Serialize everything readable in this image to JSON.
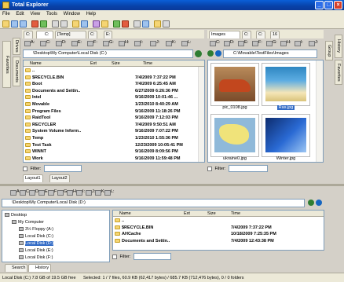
{
  "window": {
    "title": "Total Explorer"
  },
  "menu": [
    "File",
    "Edit",
    "View",
    "Tools",
    "Window",
    "Help"
  ],
  "left_panel": {
    "tabs": [
      "C:",
      "C:",
      "[Temp]",
      "C:",
      "E:"
    ],
    "drives": [
      "A:",
      "C:",
      "D:",
      "E:",
      "F:",
      "G:",
      "H:",
      "I:",
      "J:",
      "K:",
      "L:"
    ],
    "address": "\\Desktop\\My Computer\\Local Disk (C:)",
    "columns": {
      "name": "Name",
      "ext": "Ext",
      "size": "Size",
      "time": "Time"
    },
    "rows": [
      {
        "name": "..",
        "time": ""
      },
      {
        "name": "$RECYCLE.BIN",
        "time": "7/4/2009 7:37:22 PM"
      },
      {
        "name": "Boot",
        "time": "7/4/2009 6:25:45 AM"
      },
      {
        "name": "Documents and Settin..",
        "time": "6/27/2009 6:26:36 PM"
      },
      {
        "name": "Intel",
        "time": "9/16/2009 10:01:46 ..."
      },
      {
        "name": "Movable",
        "time": "1/23/2010 8:40:29 AM"
      },
      {
        "name": "Program Files",
        "time": "9/16/2009 11:18:26 PM"
      },
      {
        "name": "RaidTool",
        "time": "9/16/2009 7:12:03 PM"
      },
      {
        "name": "RECYCLER",
        "time": "7/4/2009 9:50:51 AM"
      },
      {
        "name": "System Volume Inform..",
        "time": "9/16/2009 7:07:22 PM"
      },
      {
        "name": "Temp",
        "time": "1/23/2010 1:55:36 PM"
      },
      {
        "name": "Test Task",
        "time": "12/23/2009 10:05:41 PM"
      },
      {
        "name": "WINNT",
        "time": "9/16/2009 8:09:56 PM"
      },
      {
        "name": "Work",
        "time": "9/16/2009 11:59:48 PM"
      }
    ],
    "filter_label": "Filter:",
    "layout_tabs": [
      "Layout1",
      "Layout2"
    ]
  },
  "right_panel": {
    "tabs": [
      "Images",
      "C:",
      "C:",
      "16"
    ],
    "drives": [
      "C:",
      "D:",
      "E:",
      "F:",
      "G:",
      "H:",
      "I:",
      "J:"
    ],
    "address": "C:\\Movable\\TestFiles\\Images",
    "thumbs": [
      {
        "name": "pic_0108.jpg",
        "selected": false
      },
      {
        "name": "Ras.jpg",
        "selected": true
      },
      {
        "name": "ukraine0.jpg",
        "selected": false
      },
      {
        "name": "Winter.jpg",
        "selected": false
      }
    ],
    "filter_label": "Filter:"
  },
  "side_tabs_left": [
    "Drives",
    "Documents",
    "Favorites"
  ],
  "side_tabs_right": [
    "History",
    "Group",
    "Favorites"
  ],
  "bottom_left": {
    "drives": [
      "A:",
      "C:",
      "D:",
      "E:",
      "F:",
      "G:",
      "H:",
      "I:",
      "J:",
      "K:",
      "L:"
    ],
    "address": "\\Desktop\\My Computer\\Local Disk (D:)",
    "tree": [
      {
        "label": "Desktop",
        "indent": 0
      },
      {
        "label": "My Computer",
        "indent": 1
      },
      {
        "label": "3½ Floppy (A:)",
        "indent": 2
      },
      {
        "label": "Local Disk (C:)",
        "indent": 2
      },
      {
        "label": "Local Disk (D:)",
        "indent": 2
      },
      {
        "label": "Local Disk (E:)",
        "indent": 2
      },
      {
        "label": "Local Disk (F:)",
        "indent": 2
      }
    ],
    "tabs": [
      "Search",
      "History"
    ]
  },
  "bottom_right": {
    "columns": {
      "name": "Name",
      "ext": "Ext",
      "size": "Size",
      "time": "Time"
    },
    "rows": [
      {
        "name": "..",
        "time": ""
      },
      {
        "name": "$RECYCLE.BIN",
        "time": "7/4/2009 7:37:22 PM"
      },
      {
        "name": "AHCache",
        "time": "10/18/2009 7:25:35 PM"
      },
      {
        "name": "Documents and Settin..",
        "time": "7/4/2009 12:43:38 PM"
      }
    ],
    "filter_label": "Filter:"
  },
  "status": {
    "disk": "Local Disk (C:) 7.8 GB of 19.5 GB free",
    "selection": "Selected: 1 / 7 files, 60.9 KB (62,417 bytes) / 685.7 KB (712,476 bytes), 0 / 0 folders"
  }
}
